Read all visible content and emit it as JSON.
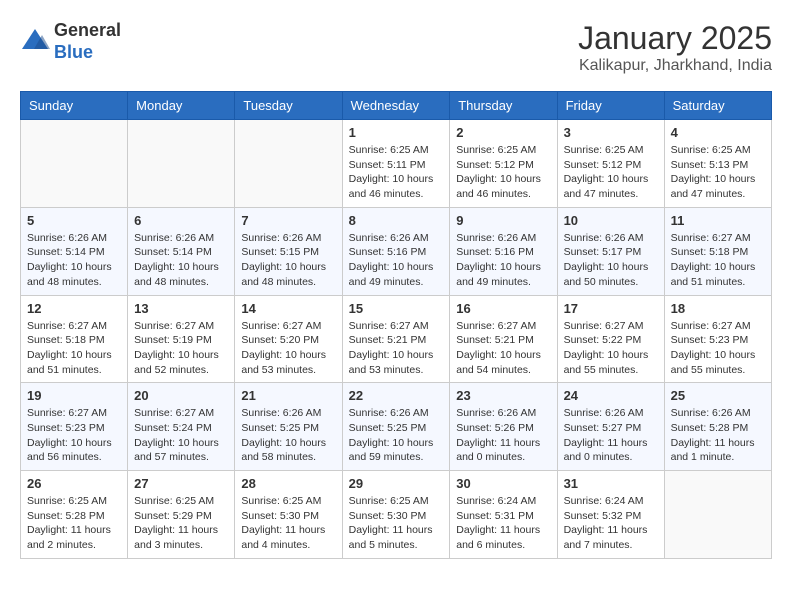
{
  "logo": {
    "general": "General",
    "blue": "Blue"
  },
  "title": "January 2025",
  "location": "Kalikapur, Jharkhand, India",
  "weekdays": [
    "Sunday",
    "Monday",
    "Tuesday",
    "Wednesday",
    "Thursday",
    "Friday",
    "Saturday"
  ],
  "weeks": [
    [
      {
        "day": "",
        "info": ""
      },
      {
        "day": "",
        "info": ""
      },
      {
        "day": "",
        "info": ""
      },
      {
        "day": "1",
        "info": "Sunrise: 6:25 AM\nSunset: 5:11 PM\nDaylight: 10 hours\nand 46 minutes."
      },
      {
        "day": "2",
        "info": "Sunrise: 6:25 AM\nSunset: 5:12 PM\nDaylight: 10 hours\nand 46 minutes."
      },
      {
        "day": "3",
        "info": "Sunrise: 6:25 AM\nSunset: 5:12 PM\nDaylight: 10 hours\nand 47 minutes."
      },
      {
        "day": "4",
        "info": "Sunrise: 6:25 AM\nSunset: 5:13 PM\nDaylight: 10 hours\nand 47 minutes."
      }
    ],
    [
      {
        "day": "5",
        "info": "Sunrise: 6:26 AM\nSunset: 5:14 PM\nDaylight: 10 hours\nand 48 minutes."
      },
      {
        "day": "6",
        "info": "Sunrise: 6:26 AM\nSunset: 5:14 PM\nDaylight: 10 hours\nand 48 minutes."
      },
      {
        "day": "7",
        "info": "Sunrise: 6:26 AM\nSunset: 5:15 PM\nDaylight: 10 hours\nand 48 minutes."
      },
      {
        "day": "8",
        "info": "Sunrise: 6:26 AM\nSunset: 5:16 PM\nDaylight: 10 hours\nand 49 minutes."
      },
      {
        "day": "9",
        "info": "Sunrise: 6:26 AM\nSunset: 5:16 PM\nDaylight: 10 hours\nand 49 minutes."
      },
      {
        "day": "10",
        "info": "Sunrise: 6:26 AM\nSunset: 5:17 PM\nDaylight: 10 hours\nand 50 minutes."
      },
      {
        "day": "11",
        "info": "Sunrise: 6:27 AM\nSunset: 5:18 PM\nDaylight: 10 hours\nand 51 minutes."
      }
    ],
    [
      {
        "day": "12",
        "info": "Sunrise: 6:27 AM\nSunset: 5:18 PM\nDaylight: 10 hours\nand 51 minutes."
      },
      {
        "day": "13",
        "info": "Sunrise: 6:27 AM\nSunset: 5:19 PM\nDaylight: 10 hours\nand 52 minutes."
      },
      {
        "day": "14",
        "info": "Sunrise: 6:27 AM\nSunset: 5:20 PM\nDaylight: 10 hours\nand 53 minutes."
      },
      {
        "day": "15",
        "info": "Sunrise: 6:27 AM\nSunset: 5:21 PM\nDaylight: 10 hours\nand 53 minutes."
      },
      {
        "day": "16",
        "info": "Sunrise: 6:27 AM\nSunset: 5:21 PM\nDaylight: 10 hours\nand 54 minutes."
      },
      {
        "day": "17",
        "info": "Sunrise: 6:27 AM\nSunset: 5:22 PM\nDaylight: 10 hours\nand 55 minutes."
      },
      {
        "day": "18",
        "info": "Sunrise: 6:27 AM\nSunset: 5:23 PM\nDaylight: 10 hours\nand 55 minutes."
      }
    ],
    [
      {
        "day": "19",
        "info": "Sunrise: 6:27 AM\nSunset: 5:23 PM\nDaylight: 10 hours\nand 56 minutes."
      },
      {
        "day": "20",
        "info": "Sunrise: 6:27 AM\nSunset: 5:24 PM\nDaylight: 10 hours\nand 57 minutes."
      },
      {
        "day": "21",
        "info": "Sunrise: 6:26 AM\nSunset: 5:25 PM\nDaylight: 10 hours\nand 58 minutes."
      },
      {
        "day": "22",
        "info": "Sunrise: 6:26 AM\nSunset: 5:25 PM\nDaylight: 10 hours\nand 59 minutes."
      },
      {
        "day": "23",
        "info": "Sunrise: 6:26 AM\nSunset: 5:26 PM\nDaylight: 11 hours\nand 0 minutes."
      },
      {
        "day": "24",
        "info": "Sunrise: 6:26 AM\nSunset: 5:27 PM\nDaylight: 11 hours\nand 0 minutes."
      },
      {
        "day": "25",
        "info": "Sunrise: 6:26 AM\nSunset: 5:28 PM\nDaylight: 11 hours\nand 1 minute."
      }
    ],
    [
      {
        "day": "26",
        "info": "Sunrise: 6:25 AM\nSunset: 5:28 PM\nDaylight: 11 hours\nand 2 minutes."
      },
      {
        "day": "27",
        "info": "Sunrise: 6:25 AM\nSunset: 5:29 PM\nDaylight: 11 hours\nand 3 minutes."
      },
      {
        "day": "28",
        "info": "Sunrise: 6:25 AM\nSunset: 5:30 PM\nDaylight: 11 hours\nand 4 minutes."
      },
      {
        "day": "29",
        "info": "Sunrise: 6:25 AM\nSunset: 5:30 PM\nDaylight: 11 hours\nand 5 minutes."
      },
      {
        "day": "30",
        "info": "Sunrise: 6:24 AM\nSunset: 5:31 PM\nDaylight: 11 hours\nand 6 minutes."
      },
      {
        "day": "31",
        "info": "Sunrise: 6:24 AM\nSunset: 5:32 PM\nDaylight: 11 hours\nand 7 minutes."
      },
      {
        "day": "",
        "info": ""
      }
    ]
  ]
}
